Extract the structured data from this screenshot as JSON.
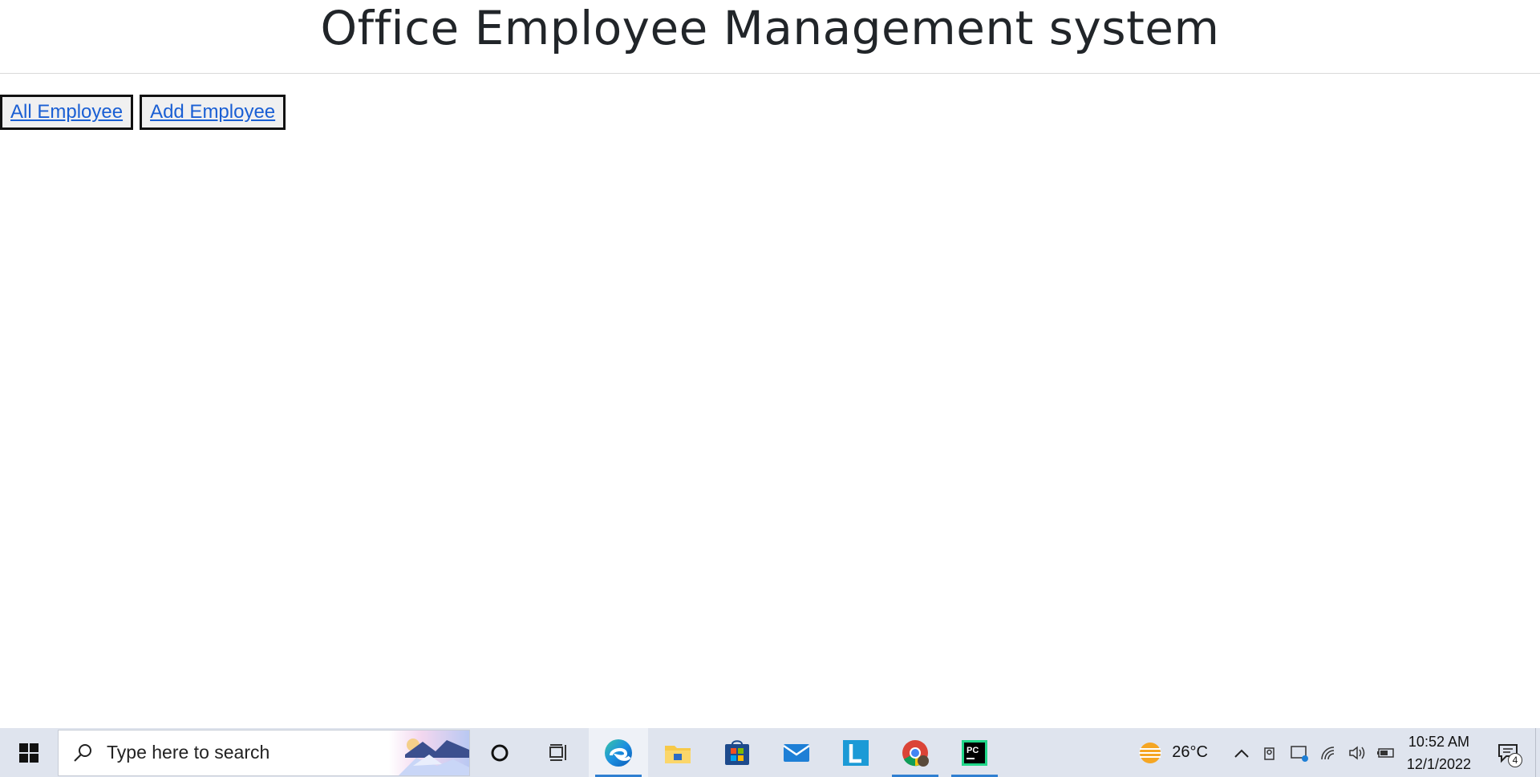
{
  "page": {
    "title": "Office Employee Management system",
    "nav": [
      {
        "label": "All Employee"
      },
      {
        "label": "Add Employee"
      }
    ]
  },
  "taskbar": {
    "search_placeholder": "Type here to search",
    "apps": [
      {
        "name": "cortana-icon"
      },
      {
        "name": "task-view-icon"
      },
      {
        "name": "edge-icon"
      },
      {
        "name": "file-explorer-icon"
      },
      {
        "name": "microsoft-store-icon"
      },
      {
        "name": "mail-icon"
      },
      {
        "name": "l-app-icon"
      },
      {
        "name": "chrome-icon"
      },
      {
        "name": "pycharm-icon"
      }
    ],
    "weather_temp": "26°C",
    "time": "10:52 AM",
    "date": "12/1/2022",
    "notification_count": "4"
  }
}
